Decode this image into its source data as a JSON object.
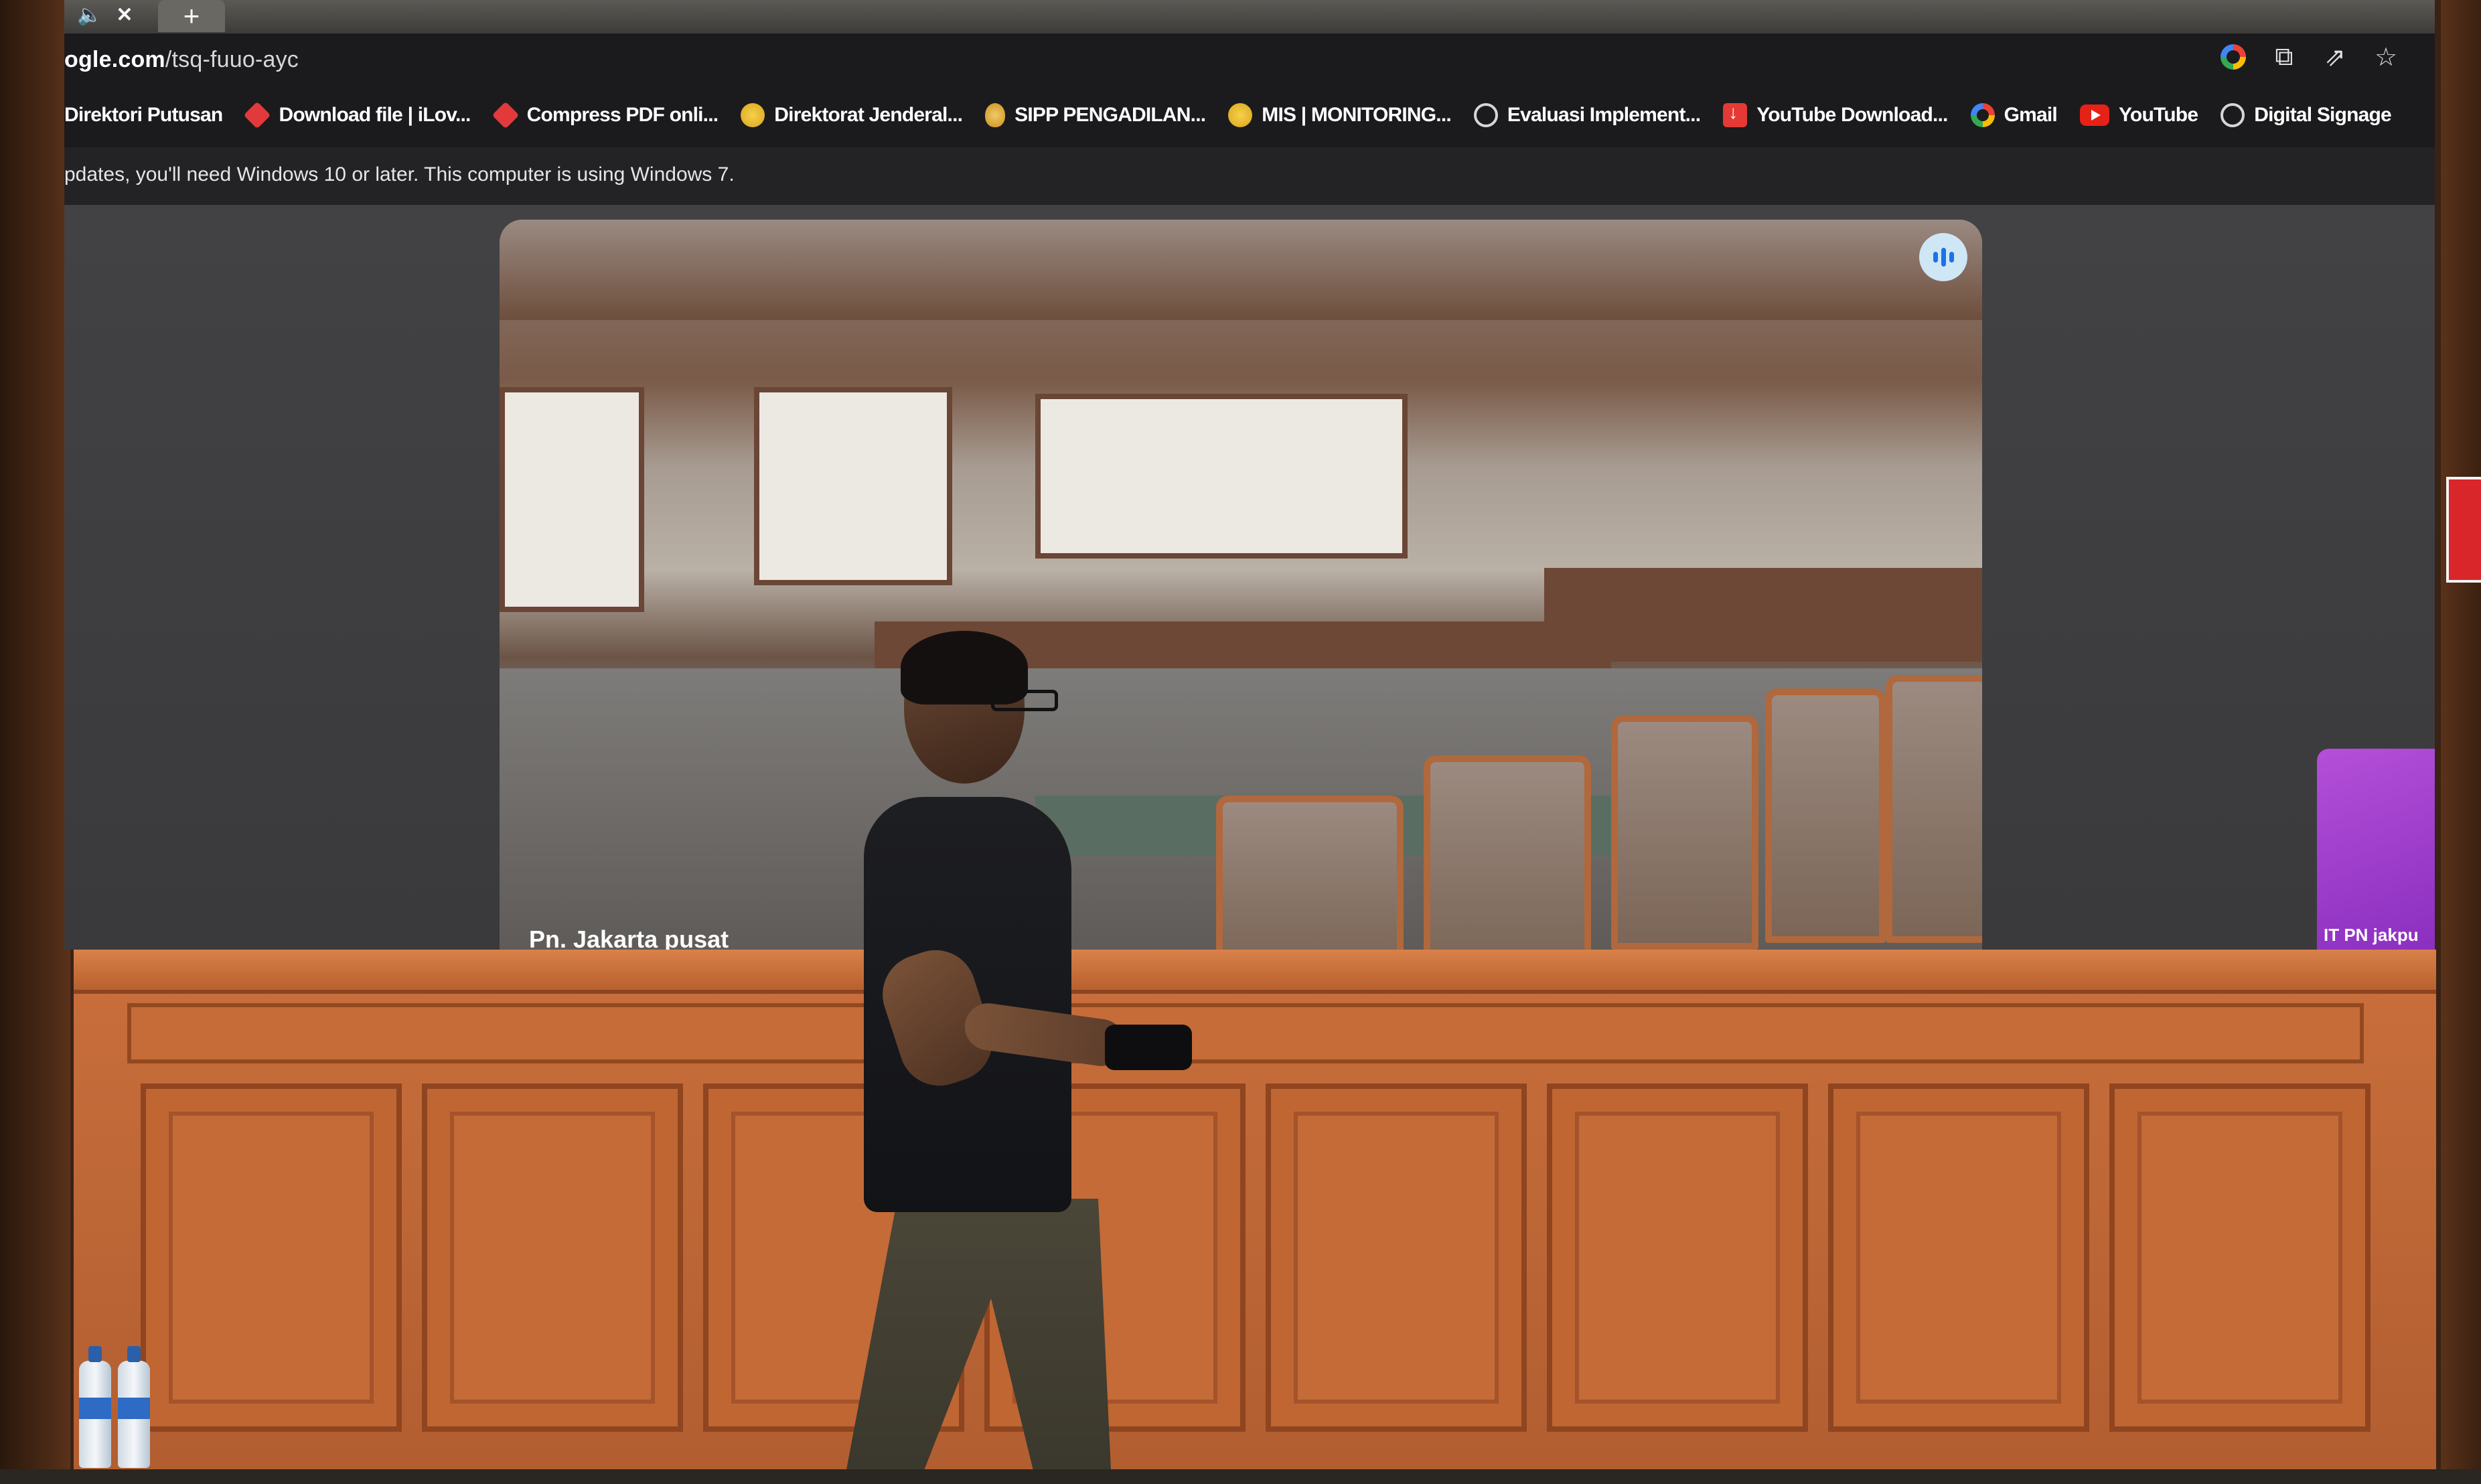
{
  "browser": {
    "tab_controls": {
      "mute": "🔈",
      "close": "✕",
      "new_tab": "+"
    },
    "url": {
      "domain": "ogle.com",
      "path": "/tsq-fuuo-ayc"
    },
    "omnibox_icons": [
      "google-icon",
      "translate-icon",
      "share-icon",
      "bookmark-star-icon"
    ],
    "bookmarks": [
      {
        "label": "Direktori Putusan",
        "icon": "none"
      },
      {
        "label": "Download file | iLov...",
        "icon": "heart-icon"
      },
      {
        "label": "Compress PDF onli...",
        "icon": "heart-icon"
      },
      {
        "label": "Direktorat Jenderal...",
        "icon": "coin-icon"
      },
      {
        "label": "SIPP PENGADILAN...",
        "icon": "egg-icon"
      },
      {
        "label": "MIS | MONITORING...",
        "icon": "coin-icon"
      },
      {
        "label": "Evaluasi Implement...",
        "icon": "globe-icon"
      },
      {
        "label": "YouTube Download...",
        "icon": "download-icon"
      },
      {
        "label": "Gmail",
        "icon": "google-icon"
      },
      {
        "label": "YouTube",
        "icon": "youtube-icon"
      },
      {
        "label": "Digital Signage",
        "icon": "globe-icon"
      }
    ],
    "infobar_text": "pdates, you'll need Windows 10 or later. This computer is using Windows 7."
  },
  "meeting": {
    "main_tile": {
      "name": "Pn. Jakarta pusat",
      "speaking_icon": "speaking-indicator-icon"
    },
    "side_tile": {
      "name": "IT PN jakpu"
    }
  },
  "colors": {
    "screen_bg": "#1b1b1d",
    "content_bg": "#3a3a3c",
    "speaking_accent": "#1a73e8",
    "side_tile": "#b44fd8",
    "wood": "#c96f3c"
  }
}
